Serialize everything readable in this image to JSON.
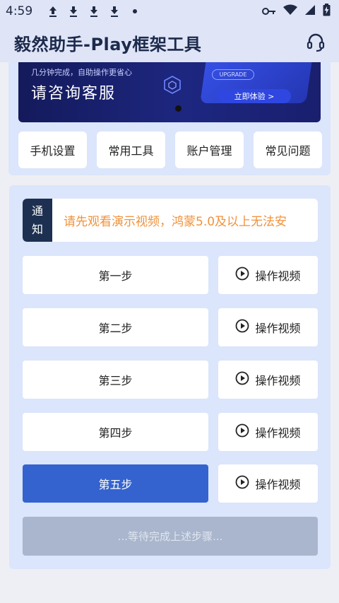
{
  "status_bar": {
    "time": "4:59",
    "notification_icons": [
      "upload-icon",
      "download-icon",
      "download-icon",
      "download-icon",
      "dot-icon"
    ],
    "right_icons": [
      "vpn-key-icon",
      "wifi-icon",
      "signal-icon",
      "battery-charging-icon"
    ]
  },
  "app_bar": {
    "title": "毅然助手-Play框架工具",
    "action_icon": "headset-icon"
  },
  "banner": {
    "small_text": "几分钟完成，自助操作更省心",
    "headline": "请咨询客服",
    "badge": "UPGRADE",
    "cta": "立即体验 >"
  },
  "quick_actions": [
    {
      "label": "手机设置"
    },
    {
      "label": "常用工具"
    },
    {
      "label": "账户管理"
    },
    {
      "label": "常见问题"
    }
  ],
  "notice": {
    "tag_top": "通",
    "tag_bottom": "知",
    "text": "请先观看演示视频，鸿蒙5.0及以上无法安"
  },
  "steps": [
    {
      "label": "第一步",
      "video_label": "操作视频",
      "active": false
    },
    {
      "label": "第二步",
      "video_label": "操作视频",
      "active": false
    },
    {
      "label": "第三步",
      "video_label": "操作视频",
      "active": false
    },
    {
      "label": "第四步",
      "video_label": "操作视频",
      "active": false
    },
    {
      "label": "第五步",
      "video_label": "操作视频",
      "active": true
    }
  ],
  "waiting_button": {
    "label": "...等待完成上述步骤..."
  },
  "colors": {
    "header_bg": "#dfe4f6",
    "card_bg": "#dbe5fb",
    "accent_blue": "#3463cf",
    "notice_orange": "#f0923b",
    "notice_tag_bg": "#1e3051",
    "disabled_bg": "#a9b6cd"
  }
}
